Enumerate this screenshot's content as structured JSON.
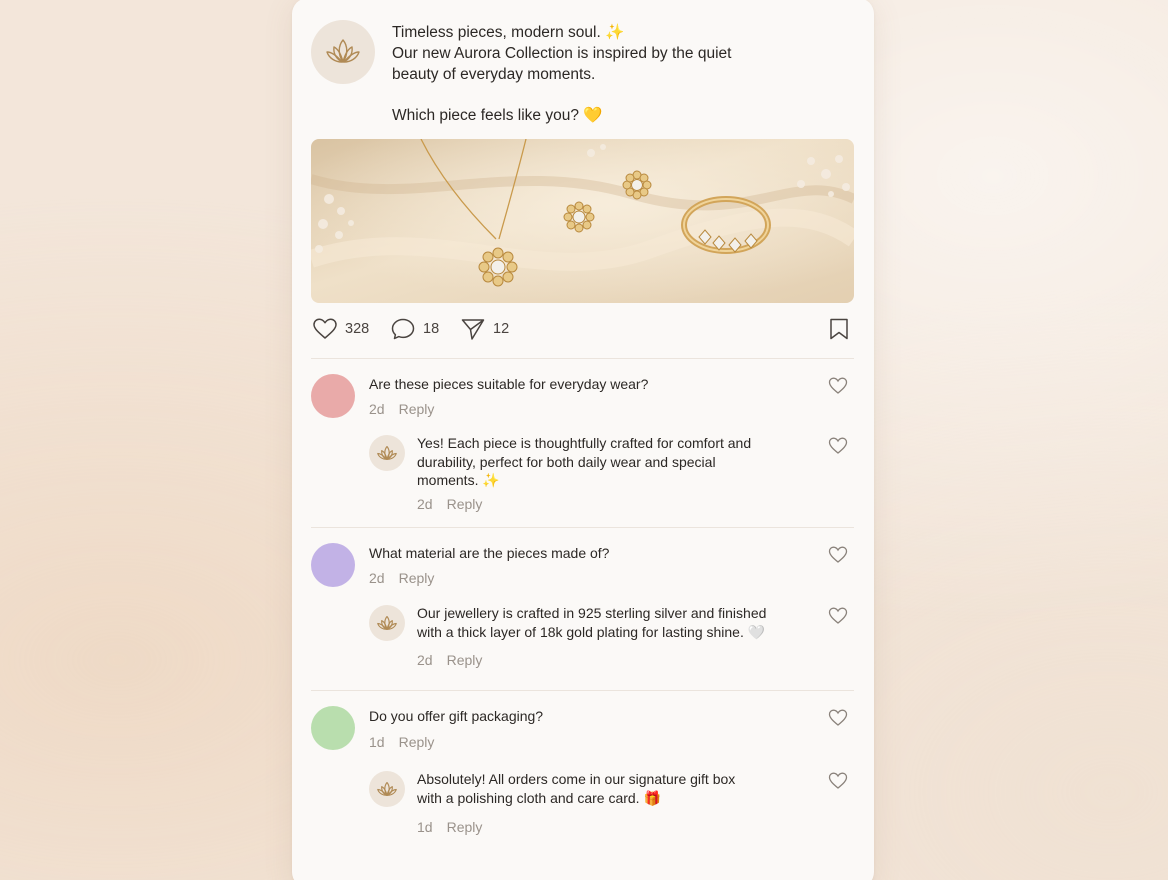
{
  "post": {
    "line1": "Timeless pieces, modern soul. ✨",
    "line2": "Our new Aurora Collection is inspired by the quiet",
    "line3": "beauty of everyday moments.",
    "line4": "Which piece feels like you? 💛",
    "image_icon": "jewelry-photo"
  },
  "actions": {
    "likes": "328",
    "comments": "18",
    "shares": "12"
  },
  "threads": [
    {
      "comment": "Are these pieces suitable for everyday wear?",
      "time": "2d",
      "reply": "Reply",
      "avatar_color": "#e9aaa9",
      "answer_line1": "Yes! Each piece is thoughtfully crafted for comfort and",
      "answer_line2": "durability, perfect for both daily wear and special",
      "answer_line3": "moments. ✨",
      "answer_time": "2d",
      "answer_reply": "Reply"
    },
    {
      "comment": "What material are the pieces made of?",
      "time": "2d",
      "reply": "Reply",
      "avatar_color": "#c2b2e6",
      "answer_line1": "Our jewellery is crafted in 925 sterling silver and finished",
      "answer_line2": "with a thick layer of 18k gold plating for lasting shine. 🤍",
      "answer_time": "2d",
      "answer_reply": "Reply"
    },
    {
      "comment": "Do you offer gift packaging?",
      "time": "1d",
      "reply": "Reply",
      "avatar_color": "#b9deae",
      "answer_line1": "Absolutely! All orders come in our signature gift box",
      "answer_line2": "with a polishing cloth and care card. 🎁",
      "answer_time": "1d",
      "answer_reply": "Reply"
    }
  ],
  "colors": {
    "brand_gold": "#b08a55",
    "icon_gray": "#4a4440",
    "muted_text": "#9a928b"
  }
}
